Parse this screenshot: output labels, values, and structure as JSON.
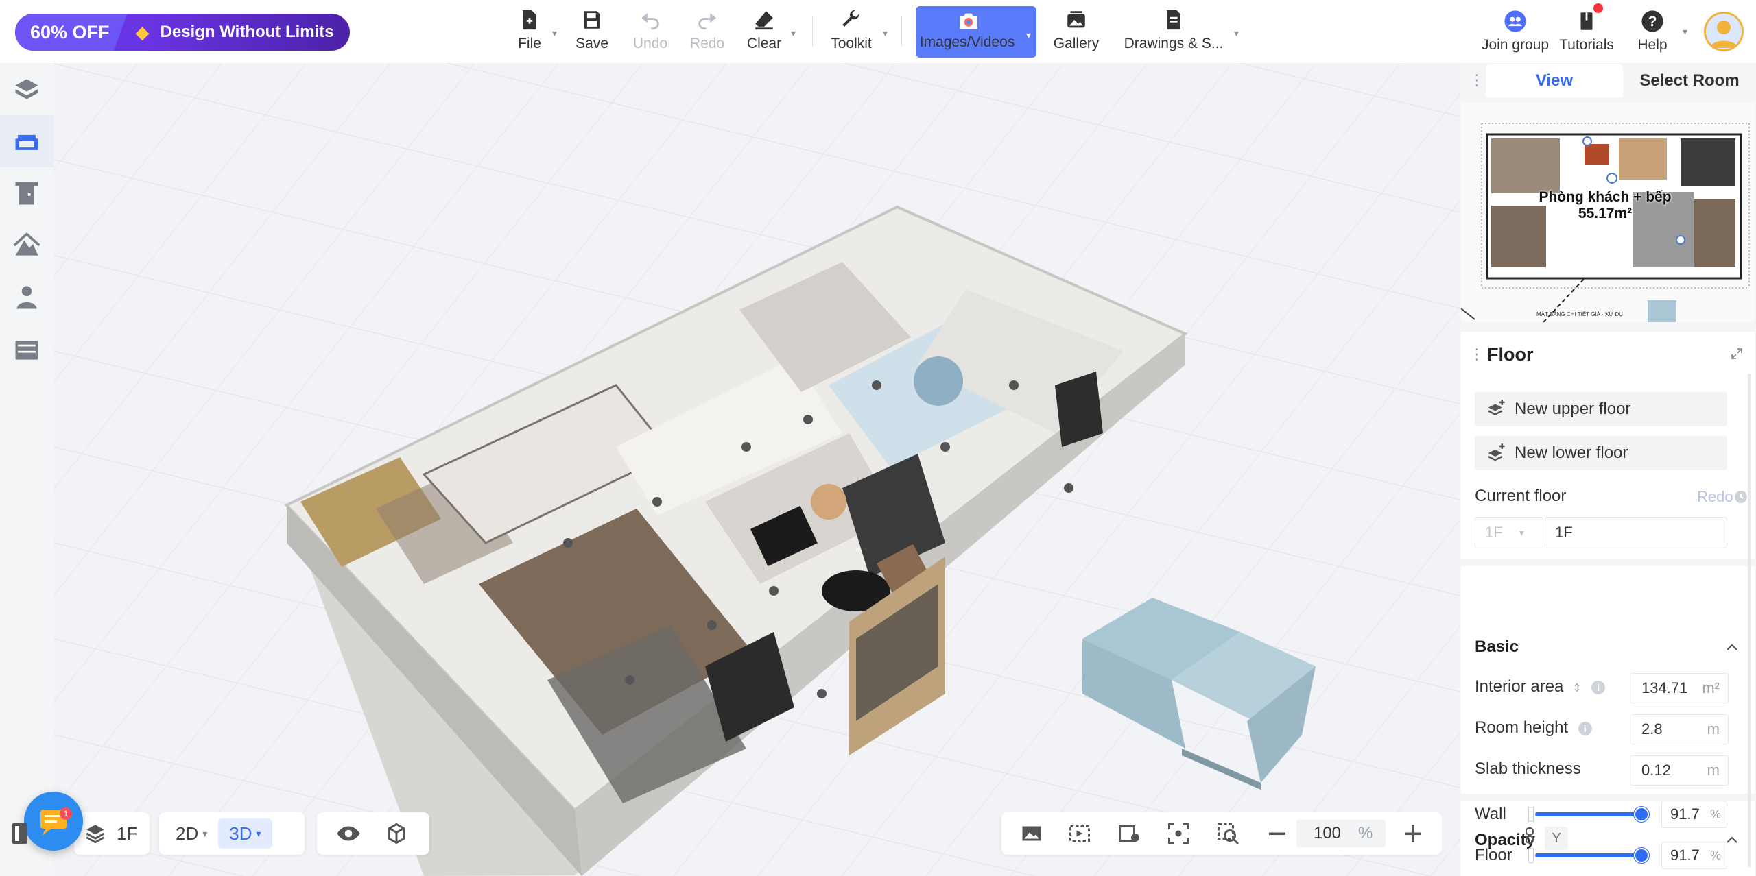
{
  "promo": {
    "discount": "60% OFF",
    "tagline": "Design Without Limits"
  },
  "toolbar": {
    "file": "File",
    "save": "Save",
    "undo": "Undo",
    "redo": "Redo",
    "clear": "Clear",
    "toolkit": "Toolkit",
    "images_videos": "Images/Videos",
    "gallery": "Gallery",
    "drawings": "Drawings & S...",
    "join_group": "Join group",
    "tutorials": "Tutorials",
    "help": "Help"
  },
  "left_tools": [
    "build-icon",
    "furniture-icon",
    "doors-windows-icon",
    "terrain-icon",
    "people-icon",
    "cabinet-icon"
  ],
  "bottom_left": {
    "chat_badge": "1",
    "floor": "1F",
    "mode_2d": "2D",
    "mode_3d": "3D"
  },
  "zoom": {
    "value": "100",
    "unit": "%"
  },
  "right_panel": {
    "tabs": {
      "view": "View",
      "select_room": "Select Room"
    },
    "minimap": {
      "room_name": "Phòng khách + bếp",
      "room_area": "55.17m²",
      "footer_note": "MẶT BẰNG CHI TIẾT GIÁ - XỬ DỤ"
    },
    "floor": {
      "title": "Floor",
      "new_upper": "New upper floor",
      "new_lower": "New lower floor",
      "current_floor_label": "Current floor",
      "redo": "Redo",
      "floor_select": "1F",
      "floor_name": "1F"
    },
    "basic": {
      "title": "Basic",
      "interior_area_label": "Interior area",
      "interior_area": "134.71",
      "interior_area_unit": "m²",
      "room_height_label": "Room height",
      "room_height": "2.8",
      "room_height_unit": "m",
      "slab_label": "Slab thickness",
      "slab": "0.12",
      "slab_unit": "m"
    },
    "opacity": {
      "title": "Opacity",
      "y_chip": "Y",
      "wall_label": "Wall",
      "wall": "91.7",
      "floor_label": "Floor",
      "floor": "91.7",
      "unit": "%",
      "wall_level": 0.917,
      "floor_level": 0.917
    }
  },
  "colors": {
    "accent": "#3a6cf0",
    "active_tool": "#5b7cfa",
    "promo": "#5b3cf0",
    "badge": "#f5343b"
  }
}
